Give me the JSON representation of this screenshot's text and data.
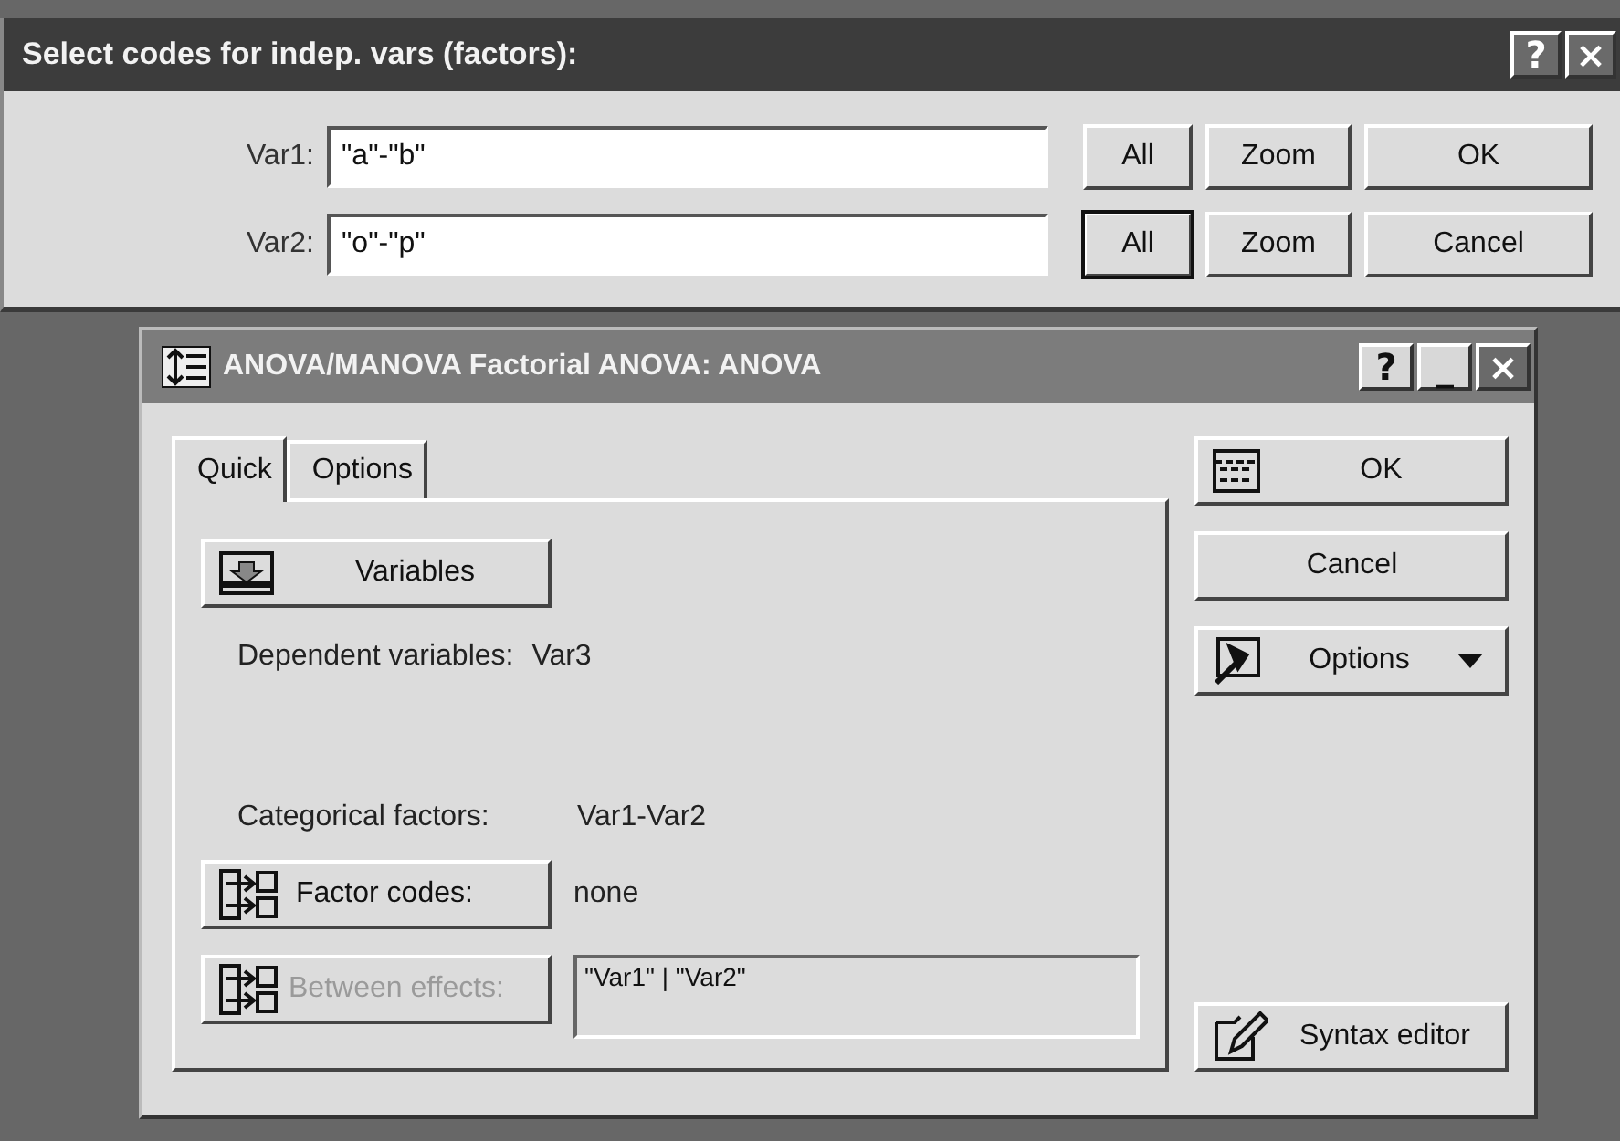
{
  "codes_dialog": {
    "title": "Select codes for indep. vars (factors):",
    "title_buttons": [
      "?",
      "×"
    ],
    "rows": [
      {
        "label": "Var1:",
        "value": "\"a\"-\"b\"",
        "all": "All",
        "all_focused": false,
        "zoom": "Zoom"
      },
      {
        "label": "Var2:",
        "value": "\"o\"-\"p\"",
        "all": "All",
        "all_focused": true,
        "zoom": "Zoom"
      }
    ],
    "buttons": [
      "OK",
      "Cancel"
    ]
  },
  "anova_window": {
    "title": "ANOVA/MANOVA Factorial ANOVA: ANOVA",
    "title_buttons": [
      "?",
      "_",
      "×"
    ],
    "tabs": [
      {
        "label": "Quick",
        "selected": true
      },
      {
        "label": "Options",
        "selected": false
      }
    ],
    "variables_button": "Variables",
    "dependent": {
      "label": "Dependent variables:",
      "value": "Var3"
    },
    "categorical": {
      "label": "Categorical factors:",
      "value": "Var1-Var2"
    },
    "factor_codes": {
      "button": "Factor codes:",
      "disabled": false,
      "value": "none"
    },
    "between_effects": {
      "button": "Between effects:",
      "disabled": true,
      "value": "\"Var1\" | \"Var2\""
    },
    "side_buttons": [
      {
        "kind": "ok",
        "label": "OK"
      },
      {
        "kind": "plain",
        "label": "Cancel"
      },
      {
        "kind": "menu",
        "label": "Options"
      },
      {
        "kind": "syntax",
        "label": "Syntax editor"
      }
    ]
  }
}
